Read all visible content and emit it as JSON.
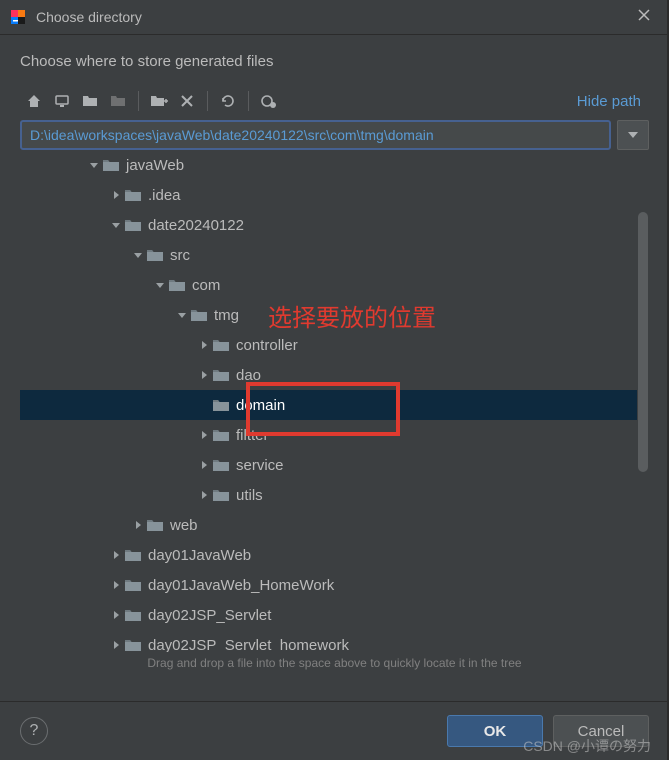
{
  "window": {
    "title": "Choose directory"
  },
  "prompt": "Choose where to store generated files",
  "toolbar": {
    "hide_path": "Hide path"
  },
  "path": {
    "value": "D:\\idea\\workspaces\\javaWeb\\date20240122\\src\\com\\tmg\\domain"
  },
  "tree": {
    "nodes": [
      {
        "depth": 3,
        "expand": "open",
        "name": "javaWeb",
        "sel": false,
        "leaf": false
      },
      {
        "depth": 4,
        "expand": "closed",
        "name": ".idea",
        "sel": false,
        "leaf": false
      },
      {
        "depth": 4,
        "expand": "open",
        "name": "date20240122",
        "sel": false,
        "leaf": false
      },
      {
        "depth": 5,
        "expand": "open",
        "name": "src",
        "sel": false,
        "leaf": false
      },
      {
        "depth": 6,
        "expand": "open",
        "name": "com",
        "sel": false,
        "leaf": false
      },
      {
        "depth": 7,
        "expand": "open",
        "name": "tmg",
        "sel": false,
        "leaf": false
      },
      {
        "depth": 8,
        "expand": "closed",
        "name": "controller",
        "sel": false,
        "leaf": false
      },
      {
        "depth": 8,
        "expand": "closed",
        "name": "dao",
        "sel": false,
        "leaf": false
      },
      {
        "depth": 8,
        "expand": "none",
        "name": "domain",
        "sel": true,
        "leaf": false
      },
      {
        "depth": 8,
        "expand": "closed",
        "name": "filtter",
        "sel": false,
        "leaf": false
      },
      {
        "depth": 8,
        "expand": "closed",
        "name": "service",
        "sel": false,
        "leaf": false
      },
      {
        "depth": 8,
        "expand": "closed",
        "name": "utils",
        "sel": false,
        "leaf": false
      },
      {
        "depth": 5,
        "expand": "closed",
        "name": "web",
        "sel": false,
        "leaf": false
      },
      {
        "depth": 4,
        "expand": "closed",
        "name": "day01JavaWeb",
        "sel": false,
        "leaf": false
      },
      {
        "depth": 4,
        "expand": "closed",
        "name": "day01JavaWeb_HomeWork",
        "sel": false,
        "leaf": false
      },
      {
        "depth": 4,
        "expand": "closed",
        "name": "day02JSP_Servlet",
        "sel": false,
        "leaf": false
      },
      {
        "depth": 4,
        "expand": "closed",
        "name": "day02JSP_Servlet_homework",
        "sel": false,
        "leaf": false
      }
    ]
  },
  "hint": "Drag and drop a file into the space above to quickly locate it in the tree",
  "buttons": {
    "ok": "OK",
    "cancel": "Cancel",
    "help": "?"
  },
  "annotation": {
    "text": "选择要放的位置",
    "box_target_label": "domain"
  },
  "watermark": "CSDN @小谭の努力",
  "colors": {
    "bg": "#3c3f41",
    "accent": "#365880",
    "link": "#5a9bd4",
    "selection": "#0d293e",
    "annotation": "#e03a2f"
  }
}
